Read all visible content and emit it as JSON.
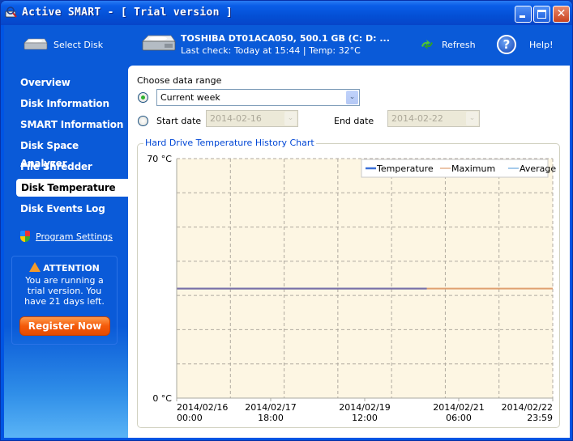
{
  "window": {
    "title": "Active SMART - [ Trial version ]",
    "controls": {
      "minimize": "_",
      "maximize": "□",
      "close": "✕"
    }
  },
  "header": {
    "select_disk_label": "Select Disk",
    "disk_name": "TOSHIBA DT01ACA050, 500.1 GB (C: D: ...",
    "disk_status": "Last check: Today at 15:44 | Temp: 32°C",
    "refresh_label": "Refresh",
    "help_label": "Help!",
    "help_glyph": "?"
  },
  "sidebar": {
    "items": [
      {
        "label": "Overview",
        "active": false
      },
      {
        "label": "Disk Information",
        "active": false
      },
      {
        "label": "SMART Information",
        "active": false
      },
      {
        "label": "Disk Space Analyzer",
        "active": false
      },
      {
        "label": "File Shredder",
        "active": false
      },
      {
        "label": "Disk Temperature",
        "active": true
      },
      {
        "label": "Disk Events Log",
        "active": false
      }
    ],
    "settings_label": "Program Settings",
    "attention": {
      "title": "ATTENTION",
      "text": "You are running a trial version. You have 21 days left.",
      "register_label": "Register Now"
    }
  },
  "main": {
    "range_label": "Choose data range",
    "range_option_selected": "Current week",
    "range_radio_checked": "preset",
    "start_date_label": "Start date",
    "start_date_value": "2014-02-16",
    "end_date_label": "End date",
    "end_date_value": "2014-02-22",
    "chart_group_title": "Hard Drive Temperature History Chart",
    "dropdown_arrow": "⌄"
  },
  "chart_data": {
    "type": "line",
    "title": "Hard Drive Temperature History Chart",
    "xlabel": "",
    "ylabel": "",
    "ylim": [
      0,
      70
    ],
    "y_tick_labels": [
      "70 °C",
      "0 °C"
    ],
    "x_range": [
      "2014/02/16 00:00",
      "2014/02/22 23:59"
    ],
    "x_tick_labels": [
      {
        "date": "2014/02/16",
        "time": "00:00"
      },
      {
        "date": "2014/02/17",
        "time": "18:00"
      },
      {
        "date": "2014/02/19",
        "time": "12:00"
      },
      {
        "date": "2014/02/21",
        "time": "06:00"
      },
      {
        "date": "2014/02/22",
        "time": "23:59"
      }
    ],
    "grid": true,
    "legend_position": "top-right",
    "series": [
      {
        "name": "Temperature",
        "color": "#3a6fd8",
        "x": [
          0,
          0.665
        ],
        "values": [
          32,
          32
        ]
      },
      {
        "name": "Maximum",
        "color": "#e0a070",
        "x": [
          0,
          1
        ],
        "values": [
          32,
          32
        ]
      },
      {
        "name": "Average",
        "color": "#6aa8e0",
        "x": [
          0,
          0.665
        ],
        "values": [
          32,
          32
        ]
      }
    ],
    "x_note": "x positions are fractions of the week range"
  },
  "colors": {
    "accent": "#0a5ad8",
    "register": "#f45a0a",
    "chart_bg": "#fdf6e3"
  }
}
